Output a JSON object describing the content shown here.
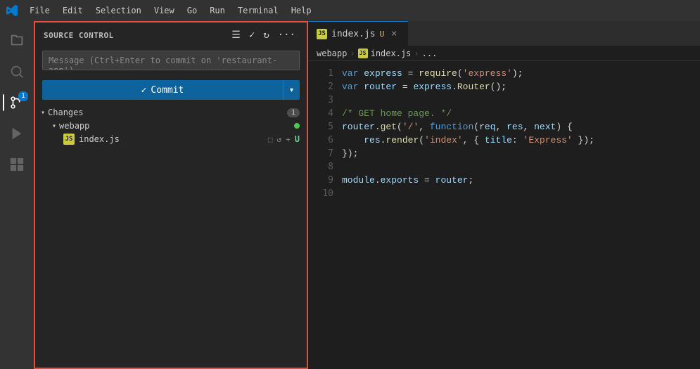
{
  "titlebar": {
    "menu_items": [
      "File",
      "Edit",
      "Selection",
      "View",
      "Go",
      "Run",
      "Terminal",
      "Help"
    ]
  },
  "activity_bar": {
    "icons": [
      {
        "name": "explorer-icon",
        "symbol": "📄",
        "active": false
      },
      {
        "name": "search-icon",
        "symbol": "🔍",
        "active": false
      },
      {
        "name": "source-control-icon",
        "symbol": "⎇",
        "active": true
      },
      {
        "name": "run-icon",
        "symbol": "▷",
        "active": false
      },
      {
        "name": "extensions-icon",
        "symbol": "⊞",
        "active": false
      }
    ]
  },
  "source_control": {
    "title": "SOURCE CONTROL",
    "message_placeholder": "Message (Ctrl+Enter to commit on 'restaurant-app')",
    "commit_button": "Commit",
    "changes_label": "Changes",
    "changes_count": "1",
    "webapp_label": "webapp",
    "file_name": "index.js",
    "untracked": "U"
  },
  "editor": {
    "tab_filename": "index.js",
    "tab_modified": "U",
    "breadcrumb": [
      "webapp",
      "JS index.js",
      "..."
    ],
    "lines": [
      {
        "num": "1",
        "content": "var express = require('express');"
      },
      {
        "num": "2",
        "content": "var router = express.Router();"
      },
      {
        "num": "3",
        "content": ""
      },
      {
        "num": "4",
        "content": "/* GET home page. */"
      },
      {
        "num": "5",
        "content": "router.get('/', function(req, res, next) {"
      },
      {
        "num": "6",
        "content": "    res.render('index', { title: 'Express' });"
      },
      {
        "num": "7",
        "content": "});"
      },
      {
        "num": "8",
        "content": ""
      },
      {
        "num": "9",
        "content": "module.exports = router;"
      },
      {
        "num": "10",
        "content": ""
      }
    ]
  }
}
